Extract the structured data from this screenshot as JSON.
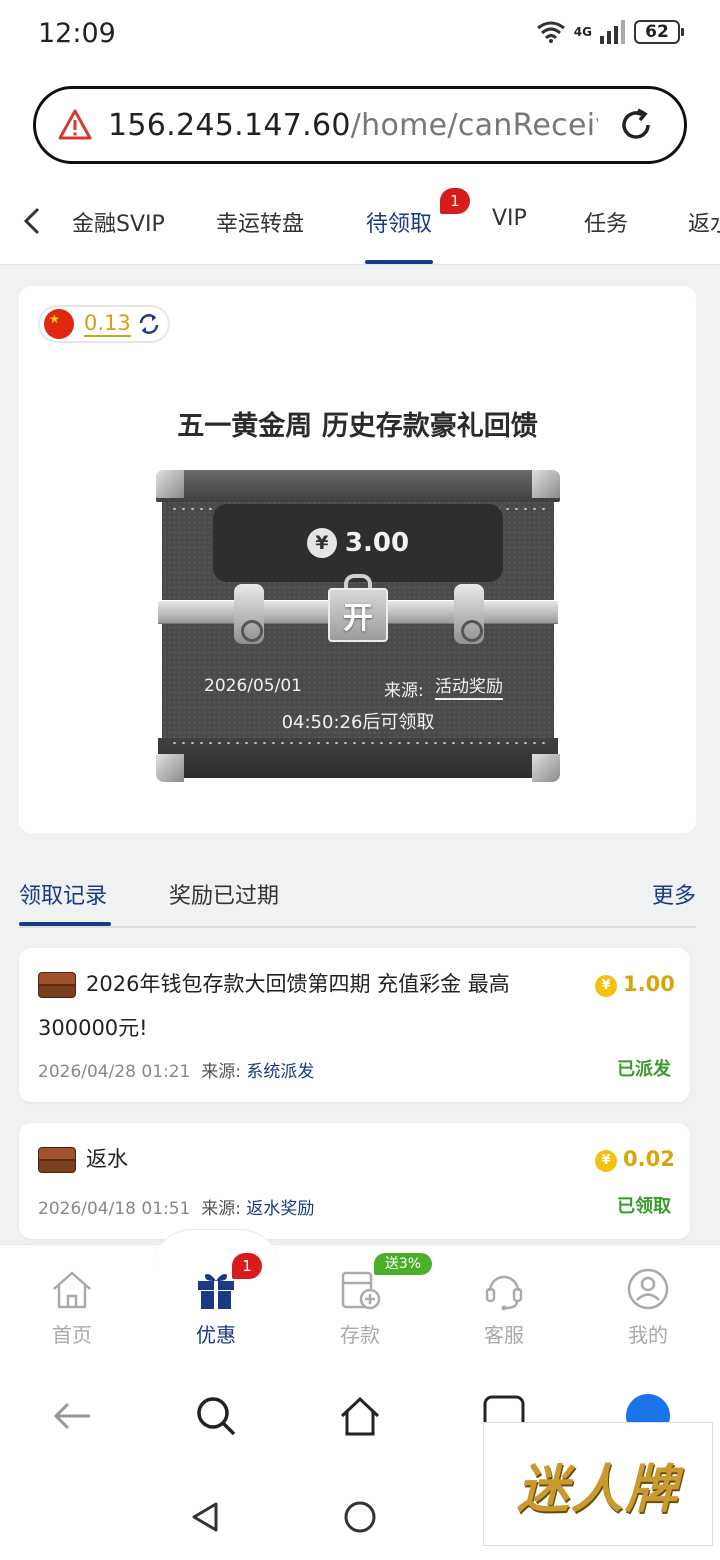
{
  "status": {
    "time": "12:09",
    "network": "4G",
    "battery": "62"
  },
  "browser": {
    "url_host": "156.245.147.60",
    "url_path": "/home/canReceive"
  },
  "tabs": {
    "items": [
      "金融SVIP",
      "幸运转盘",
      "待领取",
      "VIP",
      "任务",
      "返水"
    ],
    "active_badge": "1"
  },
  "card": {
    "balance": "0.13",
    "title": "五一黄金周 历史存款豪礼回馈",
    "chest": {
      "currency_symbol": "¥",
      "amount": "3.00",
      "open_label": "开",
      "date": "2026/05/01",
      "source_label": "来源:",
      "source_value": "活动奖励",
      "countdown": "04:50:26后可领取"
    }
  },
  "records": {
    "tabs": [
      "领取记录",
      "奖励已过期"
    ],
    "more": "更多",
    "items": [
      {
        "title_line1": "2026年钱包存款大回馈第四期 充值彩金 最高",
        "title_line2": "300000元!",
        "datetime": "2026/04/28 01:21",
        "source_label": "来源:",
        "source": "系统派发",
        "amount": "1.00",
        "status": "已派发"
      },
      {
        "title_line1": "返水",
        "datetime": "2026/04/18 01:51",
        "source_label": "来源:",
        "source": "返水奖励",
        "amount": "0.02",
        "status": "已领取"
      }
    ]
  },
  "bottom_nav": {
    "items": [
      "首页",
      "优惠",
      "存款",
      "客服",
      "我的"
    ],
    "promo_badge": "1",
    "deposit_tag": "送3%"
  },
  "watermark": "迷人牌",
  "colors": {
    "accent": "#1a3a86",
    "gold": "#d8a50a",
    "green": "#3a9a2e",
    "badge_red": "#d81c1c"
  }
}
